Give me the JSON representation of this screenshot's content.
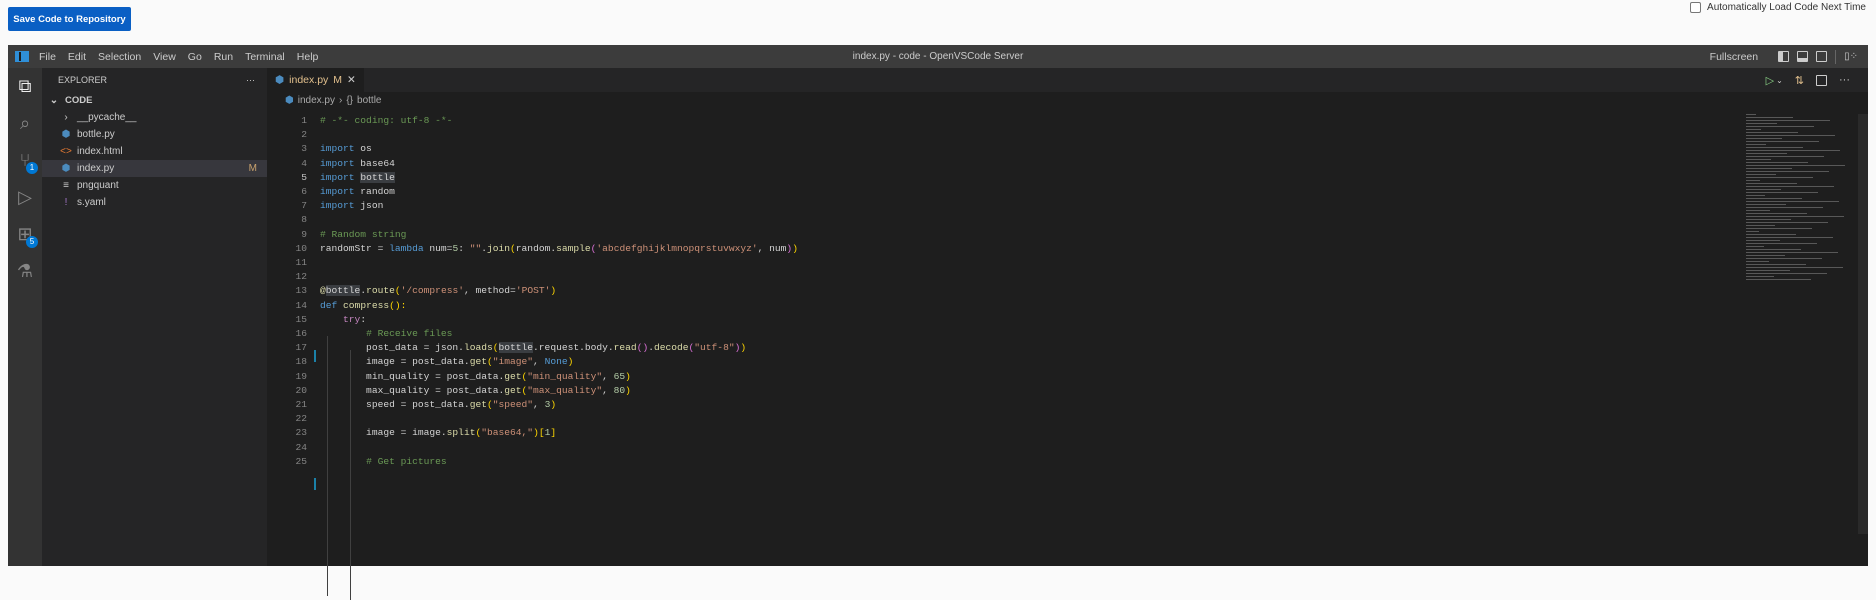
{
  "page": {
    "save_button": "Save Code to Repository",
    "autoload_label": "Automatically Load Code Next Time"
  },
  "titlebar": {
    "menus": [
      "File",
      "Edit",
      "Selection",
      "View",
      "Go",
      "Run",
      "Terminal",
      "Help"
    ],
    "title": "index.py - code - OpenVSCode Server",
    "fullscreen": "Fullscreen"
  },
  "activity": {
    "scm_badge": "1",
    "extensions_badge": "5"
  },
  "explorer": {
    "title": "EXPLORER",
    "more": "···",
    "folder": "CODE",
    "items": [
      {
        "label": "__pycache__",
        "icon": "chevron-right"
      },
      {
        "label": "bottle.py",
        "icon": "python"
      },
      {
        "label": "index.html",
        "icon": "html"
      },
      {
        "label": "index.py",
        "icon": "python",
        "status": "M"
      },
      {
        "label": "pngquant",
        "icon": "file-lines"
      },
      {
        "label": "s.yaml",
        "icon": "yaml"
      }
    ]
  },
  "tab": {
    "label": "index.py",
    "status": "M",
    "close": "✕"
  },
  "breadcrumb": {
    "file": "index.py",
    "symbol": "bottle"
  },
  "code": [
    {
      "n": "1",
      "t": [
        [
          "# -*- coding: utf-8 -*-",
          "c"
        ]
      ]
    },
    {
      "n": "2",
      "t": []
    },
    {
      "n": "3",
      "t": [
        [
          "import",
          "k"
        ],
        [
          " os",
          ""
        ]
      ]
    },
    {
      "n": "4",
      "t": [
        [
          "import",
          "k"
        ],
        [
          " base64",
          ""
        ]
      ]
    },
    {
      "n": "5",
      "t": [
        [
          "import",
          "k"
        ],
        [
          " ",
          ""
        ],
        [
          "bottle",
          "hl"
        ]
      ]
    },
    {
      "n": "6",
      "t": [
        [
          "import",
          "k"
        ],
        [
          " random",
          ""
        ]
      ]
    },
    {
      "n": "7",
      "t": [
        [
          "import",
          "k"
        ],
        [
          " json",
          ""
        ]
      ]
    },
    {
      "n": "8",
      "t": []
    },
    {
      "n": "9",
      "t": [
        [
          "# Random string",
          "c"
        ]
      ]
    },
    {
      "n": "10",
      "t": [
        [
          "randomStr = ",
          ""
        ],
        [
          "lambda",
          "k"
        ],
        [
          " num=",
          ""
        ],
        [
          "5",
          "n"
        ],
        [
          ": ",
          ""
        ],
        [
          "\"\"",
          "s"
        ],
        [
          ".",
          ""
        ],
        [
          "join",
          "f"
        ],
        [
          "(",
          "b1"
        ],
        [
          "random.",
          ""
        ],
        [
          "sample",
          "f"
        ],
        [
          "(",
          "b2"
        ],
        [
          "'abcdefghijklmnopqrstuvwxyz'",
          "s"
        ],
        [
          ", num",
          ""
        ],
        [
          ")",
          "b2"
        ],
        [
          ")",
          "b1"
        ]
      ]
    },
    {
      "n": "11",
      "t": []
    },
    {
      "n": "12",
      "t": []
    },
    {
      "n": "13",
      "t": [
        [
          "@",
          "f"
        ],
        [
          "bottle",
          "hl"
        ],
        [
          ".",
          ""
        ],
        [
          "route",
          "f"
        ],
        [
          "(",
          "b1"
        ],
        [
          "'/compress'",
          "s"
        ],
        [
          ", method=",
          ""
        ],
        [
          "'POST'",
          "s"
        ],
        [
          ")",
          "b1"
        ]
      ]
    },
    {
      "n": "14",
      "t": [
        [
          "def",
          "k"
        ],
        [
          " ",
          ""
        ],
        [
          "compress",
          "f"
        ],
        [
          "():",
          "b1"
        ]
      ]
    },
    {
      "n": "15",
      "t": [
        [
          "    ",
          ""
        ],
        [
          "try",
          "kc"
        ],
        [
          ":",
          ""
        ]
      ]
    },
    {
      "n": "16",
      "t": [
        [
          "        ",
          ""
        ],
        [
          "# Receive files",
          "c"
        ]
      ]
    },
    {
      "n": "17",
      "t": [
        [
          "        post_data = json.",
          ""
        ],
        [
          "loads",
          "f"
        ],
        [
          "(",
          "b1"
        ],
        [
          "bottle",
          "hl"
        ],
        [
          ".request.body.",
          ""
        ],
        [
          "read",
          "f"
        ],
        [
          "()",
          "b2"
        ],
        [
          ".",
          ""
        ],
        [
          "decode",
          "f"
        ],
        [
          "(",
          "b2"
        ],
        [
          "\"utf-8\"",
          "s"
        ],
        [
          ")",
          "b2"
        ],
        [
          ")",
          "b1"
        ]
      ]
    },
    {
      "n": "18",
      "t": [
        [
          "        image = post_data.",
          ""
        ],
        [
          "get",
          "f"
        ],
        [
          "(",
          "b1"
        ],
        [
          "\"image\"",
          "s"
        ],
        [
          ", ",
          ""
        ],
        [
          "None",
          "k"
        ],
        [
          ")",
          "b1"
        ]
      ]
    },
    {
      "n": "19",
      "t": [
        [
          "        min_quality = post_data.",
          ""
        ],
        [
          "get",
          "f"
        ],
        [
          "(",
          "b1"
        ],
        [
          "\"min_quality\"",
          "s"
        ],
        [
          ", ",
          ""
        ],
        [
          "65",
          "n"
        ],
        [
          ")",
          "b1"
        ]
      ]
    },
    {
      "n": "20",
      "t": [
        [
          "        max_quality = post_data.",
          ""
        ],
        [
          "get",
          "f"
        ],
        [
          "(",
          "b1"
        ],
        [
          "\"max_quality\"",
          "s"
        ],
        [
          ", ",
          ""
        ],
        [
          "80",
          "n"
        ],
        [
          ")",
          "b1"
        ]
      ]
    },
    {
      "n": "21",
      "t": [
        [
          "        speed = post_data.",
          ""
        ],
        [
          "get",
          "f"
        ],
        [
          "(",
          "b1"
        ],
        [
          "\"speed\"",
          "s"
        ],
        [
          ", ",
          ""
        ],
        [
          "3",
          "n"
        ],
        [
          ")",
          "b1"
        ]
      ]
    },
    {
      "n": "22",
      "t": []
    },
    {
      "n": "23",
      "t": [
        [
          "        image = image.",
          ""
        ],
        [
          "split",
          "f"
        ],
        [
          "(",
          "b1"
        ],
        [
          "\"base64,\"",
          "s"
        ],
        [
          ")",
          "b1"
        ],
        [
          "[",
          "b1"
        ],
        [
          "1",
          "n"
        ],
        [
          "]",
          "b1"
        ]
      ]
    },
    {
      "n": "24",
      "t": []
    },
    {
      "n": "25",
      "t": [
        [
          "        ",
          ""
        ],
        [
          "# Get pictures",
          "c"
        ]
      ]
    }
  ],
  "current_line": "5"
}
